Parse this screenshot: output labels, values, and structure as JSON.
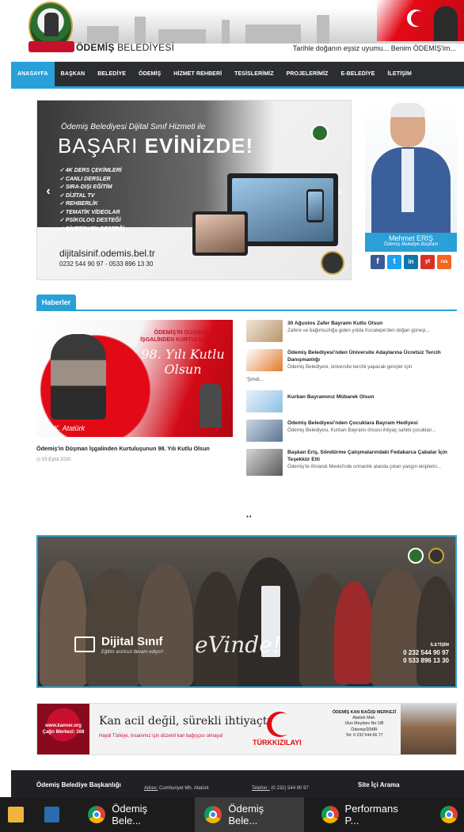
{
  "header": {
    "brand_bold": "ÖDEMİŞ",
    "brand_rest": "BELEDİYESİ",
    "tagline": "Tarihle doğanın eşsiz uyumu... Benim ÖDEMİŞ'im..."
  },
  "nav": {
    "items": [
      "ANASAYFA",
      "BAŞKAN",
      "BELEDİYE",
      "ÖDEMİŞ",
      "HİZMET REHBERİ",
      "TESİSLERİMİZ",
      "PROJELERİMİZ",
      "E-BELEDİYE",
      "İLETİŞİM"
    ],
    "active_index": 0
  },
  "slider": {
    "subtitle": "Ödemiş Belediyesi Dijital Sınıf Hizmeti ile",
    "headline_light": "BAŞARI",
    "headline_bold": "EVİNİZDE!",
    "bullets": [
      "4K DERS ÇEKİMLERİ",
      "CANLI DERSLER",
      "SIRA-DIŞI EĞİTİM",
      "DİJİTAL TV",
      "REHBERLİK",
      "TEMATİK VİDEOLAR",
      "PSİKOLOG DESTEĞİ",
      "DİYETİSYEN DESTEĞİ"
    ],
    "url": "dijitalsinif.odemis.bel.tr",
    "phones": "0232 544 90 97 - 0533 896 13 30",
    "prev": "‹",
    "next": "›"
  },
  "mayor": {
    "name": "Mehmet ERİŞ",
    "title": "Ödemiş Belediye Başkanı",
    "social": [
      "f",
      "t",
      "in",
      "yt",
      "rss"
    ],
    "social_colors": [
      "#3b5998",
      "#1da1f2",
      "#0e76a8",
      "#d93025",
      "#f26522"
    ]
  },
  "news": {
    "tab_label": "Haberler",
    "featured": {
      "img_line1": "ÖDEMİŞ'İN DÜŞMAN İŞGALİNDEN KURTULUŞUNUN",
      "img_line2": "98. Yılı Kutlu Olsun",
      "img_signature": "K. Atatürk",
      "title": "Ödemiş'in Düşman İşgalinden Kurtuluşunun 98. Yılı Kutlu Olsun",
      "date": "03 Eylül 2020"
    },
    "items": [
      {
        "title": "30 Ağustos Zafer Bayramı Kutlu Olsun",
        "desc": "Zafere ve bağımsızlığa giden yolda Kocatepe'den doğan güneşi...",
        "extra": ""
      },
      {
        "title": "Ödemiş Belediyesi'nden Üniversite Adaylarına Ücretsiz Tercih Danışmanlığı",
        "desc": "Ödemiş Belediyesi, üniversite tercihi yapacak gençler için",
        "extra": "'Şimdi..."
      },
      {
        "title": "Kurban Bayramınız Mübarek Olsun",
        "desc": "",
        "extra": ""
      },
      {
        "title": "Ödemiş Belediyesi'nden Çocuklara Bayram Hediyesi",
        "desc": "Ödemiş Belediyesi, Kurban Bayramı öncesi ihtiyaç sahibi çocukları...",
        "extra": ""
      },
      {
        "title": "Başkan Eriş, Söndürme Çalışmalarındaki Fedakarca Çabalar İçin Teşekkür Etti",
        "desc": "Ödemiş'te Ahrandı Mevkii'nde ormanlık alanda çıkan yangın ekiplerin...",
        "extra": ""
      }
    ],
    "more": "••"
  },
  "banner": {
    "title": "Dijital Sınıf",
    "subtitle": "Eğitim ara'ksız devam ediyor!",
    "script": "eVinde!",
    "contact_label": "İLETİŞİM",
    "phone1": "0 232 544 90 97",
    "phone2": "0 533 896 13 30"
  },
  "blood": {
    "site": "www.kanver.org Çağrı Merkezi: 168",
    "main": "Kan acil değil, sürekli ihtiyaçtır!",
    "sub": "Haydi Türkiye, insanımız için düzenli kan bağışçısı olmaya!",
    "brand_a": "TÜRK",
    "brand_b": "KIZILAYI",
    "center_title": "ÖDEMİŞ KAN BAĞIŞI MERKEZİ",
    "center_lines": [
      "Atatürk Mah.",
      "Ulus Meydanı No:1/B",
      "Ödemiş/İZMİR",
      "Tel: 0 232 544 66 77"
    ]
  },
  "footer": {
    "col1": "Ödemiş Belediye Başkanlığı",
    "addr_label": "Adres:",
    "addr": "Cumhuriyet Mh. Atatürk",
    "phone_label": "Telefon :",
    "phone": "(0 232) 544 90 97",
    "col4": "Site İçi Arama"
  },
  "taskbar": {
    "tasks": [
      "Ödemiş Bele...",
      "Ödemiş Bele...",
      "Performans P..."
    ],
    "active_index": 1
  }
}
